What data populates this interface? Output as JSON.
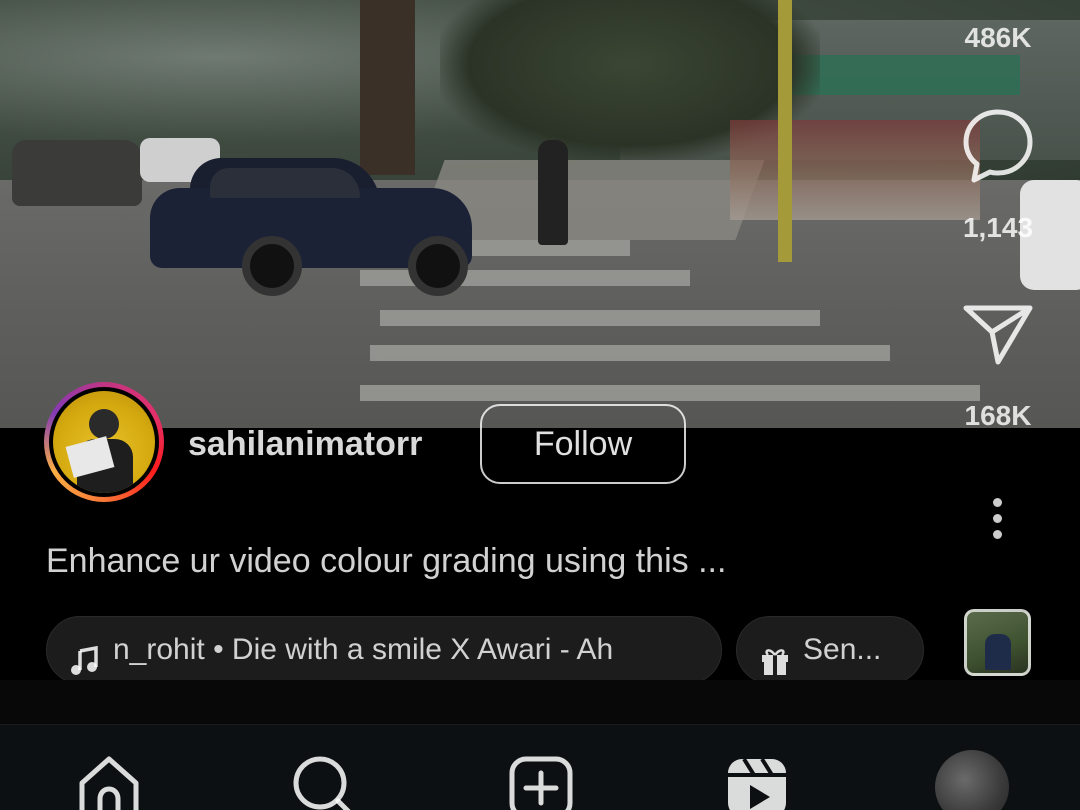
{
  "post": {
    "username": "sahilanimatorr",
    "follow_label": "Follow",
    "caption": "Enhance ur video colour grading using this ..."
  },
  "actions": {
    "likes": "486K",
    "comments": "1,143",
    "shares": "168K"
  },
  "audio": {
    "music_text": "n_rohit • Die with a smile X Awari - Ah",
    "gift_text": "Sen..."
  },
  "icons": {
    "like": "heart-icon",
    "comment": "comment-icon",
    "share": "send-icon",
    "more": "more-vertical-icon",
    "music": "music-note-icon",
    "gift": "gift-icon",
    "home": "home-icon",
    "search": "search-icon",
    "create": "add-post-icon",
    "reels": "reels-icon",
    "profile": "profile-avatar"
  },
  "colors": {
    "background": "#000000",
    "navbar": "#0d1012",
    "chip": "#1c1c1c"
  }
}
